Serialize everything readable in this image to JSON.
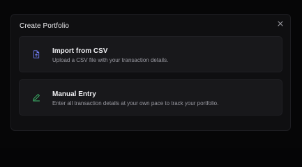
{
  "modal": {
    "title": "Create Portfolio",
    "close_icon": "close-icon"
  },
  "options": [
    {
      "label": "Import from CSV",
      "description": "Upload a CSV file with your transaction details.",
      "icon": "file-upload-icon",
      "icon_color": "#6f7cf0"
    },
    {
      "label": "Manual Entry",
      "description": "Enter all transaction details at your own pace to track your portfolio.",
      "icon": "pencil-icon",
      "icon_color": "#3fbf6f"
    }
  ],
  "colors": {
    "background": "#060607",
    "modal_bg": "#0f0f11",
    "card_bg": "#18181b",
    "text_primary": "#ededf0",
    "text_secondary": "#9a9aa2"
  }
}
